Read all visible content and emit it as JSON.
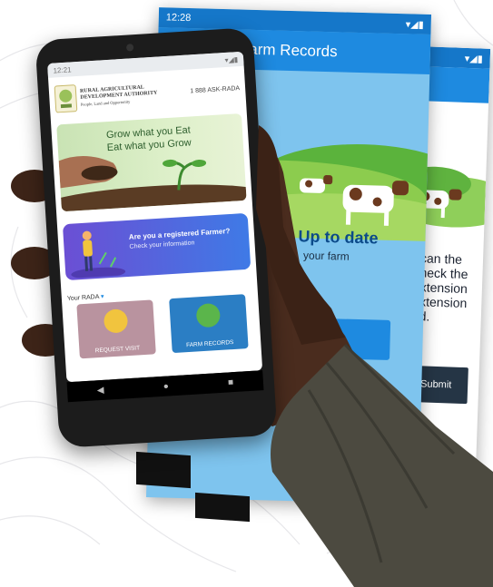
{
  "back_screen_a": {
    "status_time": "12:28",
    "app_title": "Farm Records",
    "headline": "Up to date",
    "subtext": "your farm"
  },
  "back_screen_b": {
    "text_lines": [
      "scan  the",
      "check  the",
      "extension",
      "extension",
      "ed."
    ],
    "submit_label": "Submit"
  },
  "phone": {
    "status_time": "12:21",
    "org_line1": "RURAL AGRICULTURAL",
    "org_line2": "DEVELOPMENT AUTHORITY",
    "org_tagline": "People, Land and Opportunity",
    "phone_number": "1 888 ASK-RADA",
    "hero_line1": "Grow what you Eat",
    "hero_line2": "Eat what you Grow",
    "register_title": "Are you a registered Farmer?",
    "register_sub": "Check your information",
    "rada_selector": "Your RADA",
    "tile_request": "REQUEST VISIT",
    "tile_records": "FARM RECORDS"
  },
  "colors": {
    "app_blue": "#1e8ae0",
    "banner_purple": "#6b4fd4",
    "tile_pink": "#b9939f",
    "tile_blue": "#2b7ec4"
  }
}
